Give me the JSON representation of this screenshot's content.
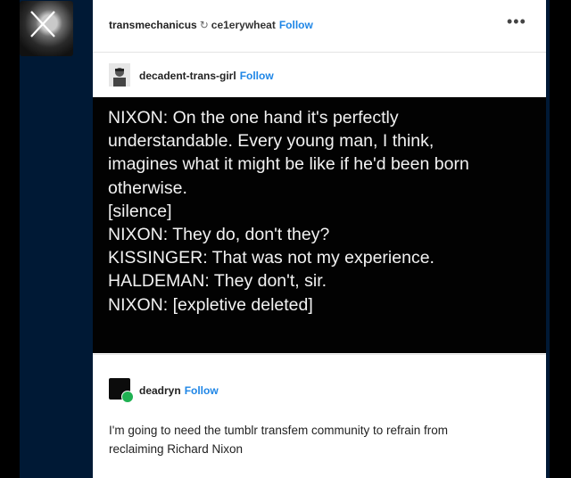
{
  "post": {
    "author": "transmechanicus",
    "reblog_icon": "reblog-icon",
    "reblogged_from": "ce1erywheat",
    "follow_label": "Follow",
    "more_label": "•••"
  },
  "quoted_post": {
    "author": "decadent-trans-girl",
    "follow_label": "Follow",
    "lines": [
      "NIXON: On the one hand it's perfectly",
      "understandable. Every young man, I think,",
      "imagines what it might be like if he'd been born",
      "otherwise.",
      "[silence]",
      "NIXON: They do, don't they?",
      "KISSINGER: That was not my experience.",
      "HALDEMAN: They don't, sir.",
      "NIXON: [expletive deleted]"
    ]
  },
  "reply": {
    "author": "deadryn",
    "follow_label": "Follow",
    "body_lines": [
      "I'm going to need the tumblr transfem community to refrain from",
      "reclaiming Richard Nixon"
    ]
  },
  "colors": {
    "dashboard_bg": "#001935",
    "follow": "#1f86e6",
    "online_badge": "#1fb152"
  }
}
